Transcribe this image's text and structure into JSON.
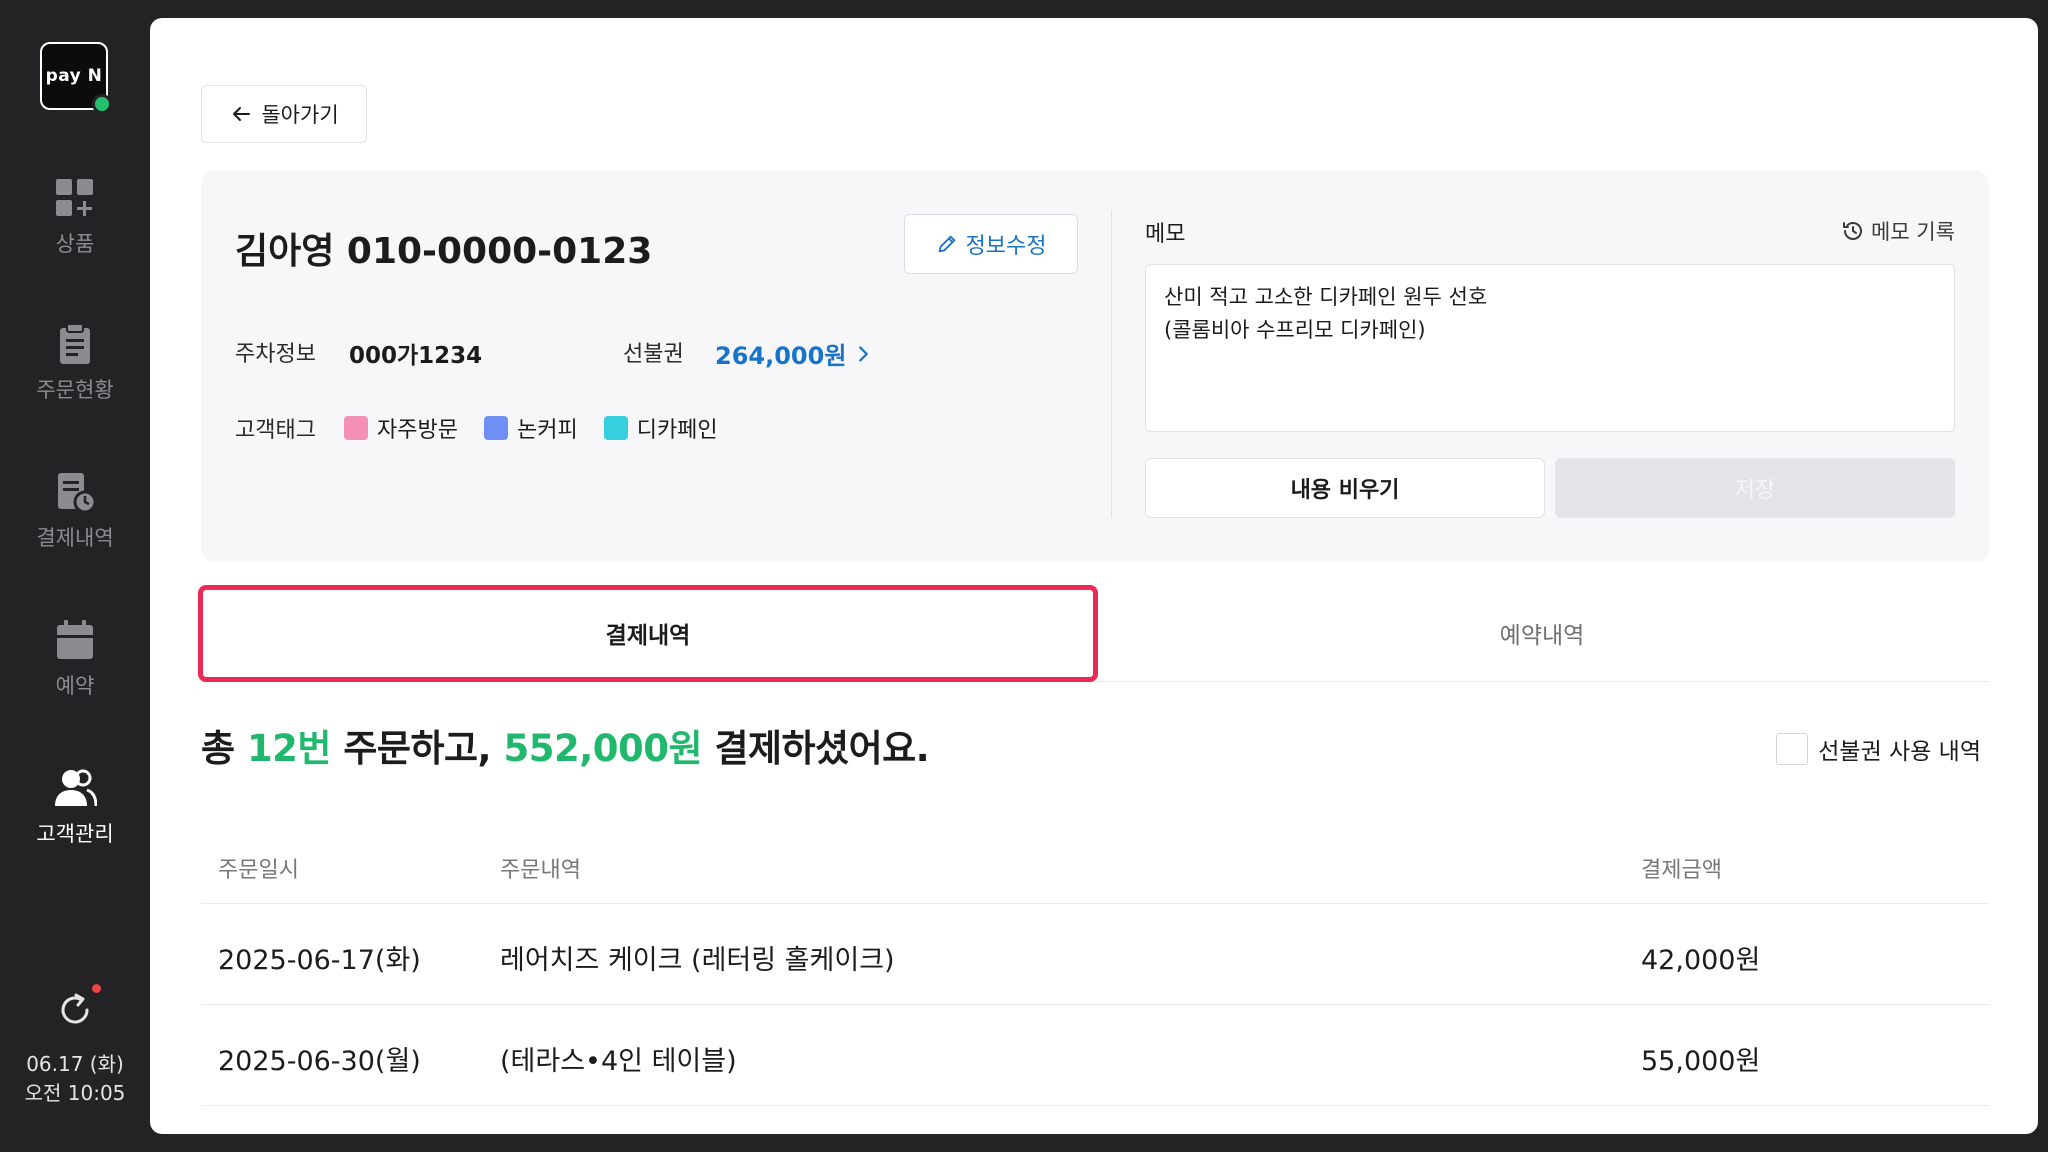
{
  "sidebar": {
    "logo_text": "pay N",
    "items": [
      {
        "label": "상품",
        "icon": "product-grid-icon"
      },
      {
        "label": "주문현황",
        "icon": "clipboard-icon"
      },
      {
        "label": "결제내역",
        "icon": "receipt-clock-icon"
      },
      {
        "label": "예약",
        "icon": "calendar-icon"
      },
      {
        "label": "고객관리",
        "icon": "users-icon"
      }
    ],
    "active_item": "고객관리",
    "date": "06.17 (화)",
    "time": "오전 10:05"
  },
  "header": {
    "back_label": "돌아가기"
  },
  "customer": {
    "name_phone": "김아영 010-0000-0123",
    "edit_label": "정보수정",
    "parking_label": "주차정보",
    "parking_value": "000가1234",
    "voucher_label": "선불권",
    "voucher_value": "264,000원",
    "tags_label": "고객태그",
    "tags": [
      {
        "label": "자주방문",
        "color": "#f48fb8"
      },
      {
        "label": "논커피",
        "color": "#6f8ff4"
      },
      {
        "label": "디카페인",
        "color": "#35d0e0"
      }
    ]
  },
  "memo": {
    "title": "메모",
    "history_label": "메모 기록",
    "content": "산미 적고 고소한 디카페인 원두 선호\n(콜롬비아 수프리모 디카페인)",
    "clear_label": "내용 비우기",
    "save_label": "저장"
  },
  "tabs": {
    "payments": "결제내역",
    "reservations": "예약내역"
  },
  "summary": {
    "prefix": "총",
    "count": "12번",
    "middle": "주문하고,",
    "amount": "552,000원",
    "suffix": "결제하셨어요.",
    "voucher_history_label": "선불권 사용 내역"
  },
  "table": {
    "headers": [
      "주문일시",
      "주문내역",
      "결제금액"
    ],
    "rows": [
      {
        "date": "2025-06-17(화)",
        "item": "레어치즈 케이크 (레터링 홀케이크)",
        "amount": "42,000원"
      },
      {
        "date": "2025-06-30(월)",
        "item": "(테라스•4인 테이블)",
        "amount": "55,000원"
      }
    ]
  },
  "colors": {
    "accent_blue": "#1774c8",
    "accent_green": "#1fb86c",
    "highlight_red": "#ea2a55",
    "sidebar_bg": "#232325"
  }
}
